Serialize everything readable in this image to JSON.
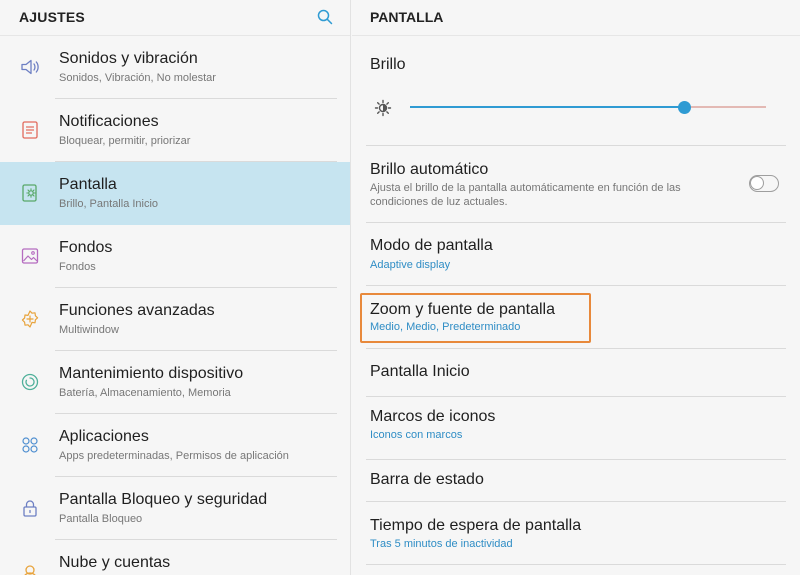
{
  "left": {
    "title": "AJUSTES",
    "items": [
      {
        "label": "Sonidos y vibración",
        "sub": "Sonidos, Vibración, No molestar",
        "icon": "speaker-icon"
      },
      {
        "label": "Notificaciones",
        "sub": "Bloquear, permitir, priorizar",
        "icon": "notifications-icon"
      },
      {
        "label": "Pantalla",
        "sub": "Brillo, Pantalla Inicio",
        "icon": "display-icon"
      },
      {
        "label": "Fondos",
        "sub": "Fondos",
        "icon": "wallpaper-icon"
      },
      {
        "label": "Funciones avanzadas",
        "sub": "Multiwindow",
        "icon": "advanced-features-icon"
      },
      {
        "label": "Mantenimiento dispositivo",
        "sub": "Batería, Almacenamiento, Memoria",
        "icon": "device-maintenance-icon"
      },
      {
        "label": "Aplicaciones",
        "sub": "Apps predeterminadas, Permisos de aplicación",
        "icon": "apps-icon"
      },
      {
        "label": "Pantalla Bloqueo y seguridad",
        "sub": "Pantalla Bloqueo",
        "icon": "lock-icon"
      },
      {
        "label": "Nube y cuentas",
        "sub": "",
        "icon": "cloud-accounts-icon"
      }
    ]
  },
  "right": {
    "title": "PANTALLA",
    "brightness": {
      "label": "Brillo",
      "level_percent": 77
    },
    "auto_brightness": {
      "label": "Brillo automático",
      "desc": "Ajusta el brillo de la pantalla automáticamente en función de las condiciones de luz actuales.",
      "enabled": false
    },
    "screen_mode": {
      "label": "Modo de pantalla",
      "sub": "Adaptive display"
    },
    "zoom_font": {
      "label": "Zoom y fuente de pantalla",
      "sub": "Medio, Medio, Predeterminado"
    },
    "home_screen": {
      "label": "Pantalla Inicio"
    },
    "icon_frames": {
      "label": "Marcos de iconos",
      "sub": "Iconos con marcos"
    },
    "status_bar": {
      "label": "Barra de estado"
    },
    "screen_timeout": {
      "label": "Tiempo de espera de pantalla",
      "sub": "Tras 5 minutos de inactividad"
    }
  },
  "colors": {
    "accent": "#2f9bd3",
    "highlight": "#e8893b",
    "active_bg": "#c6e4f0"
  }
}
